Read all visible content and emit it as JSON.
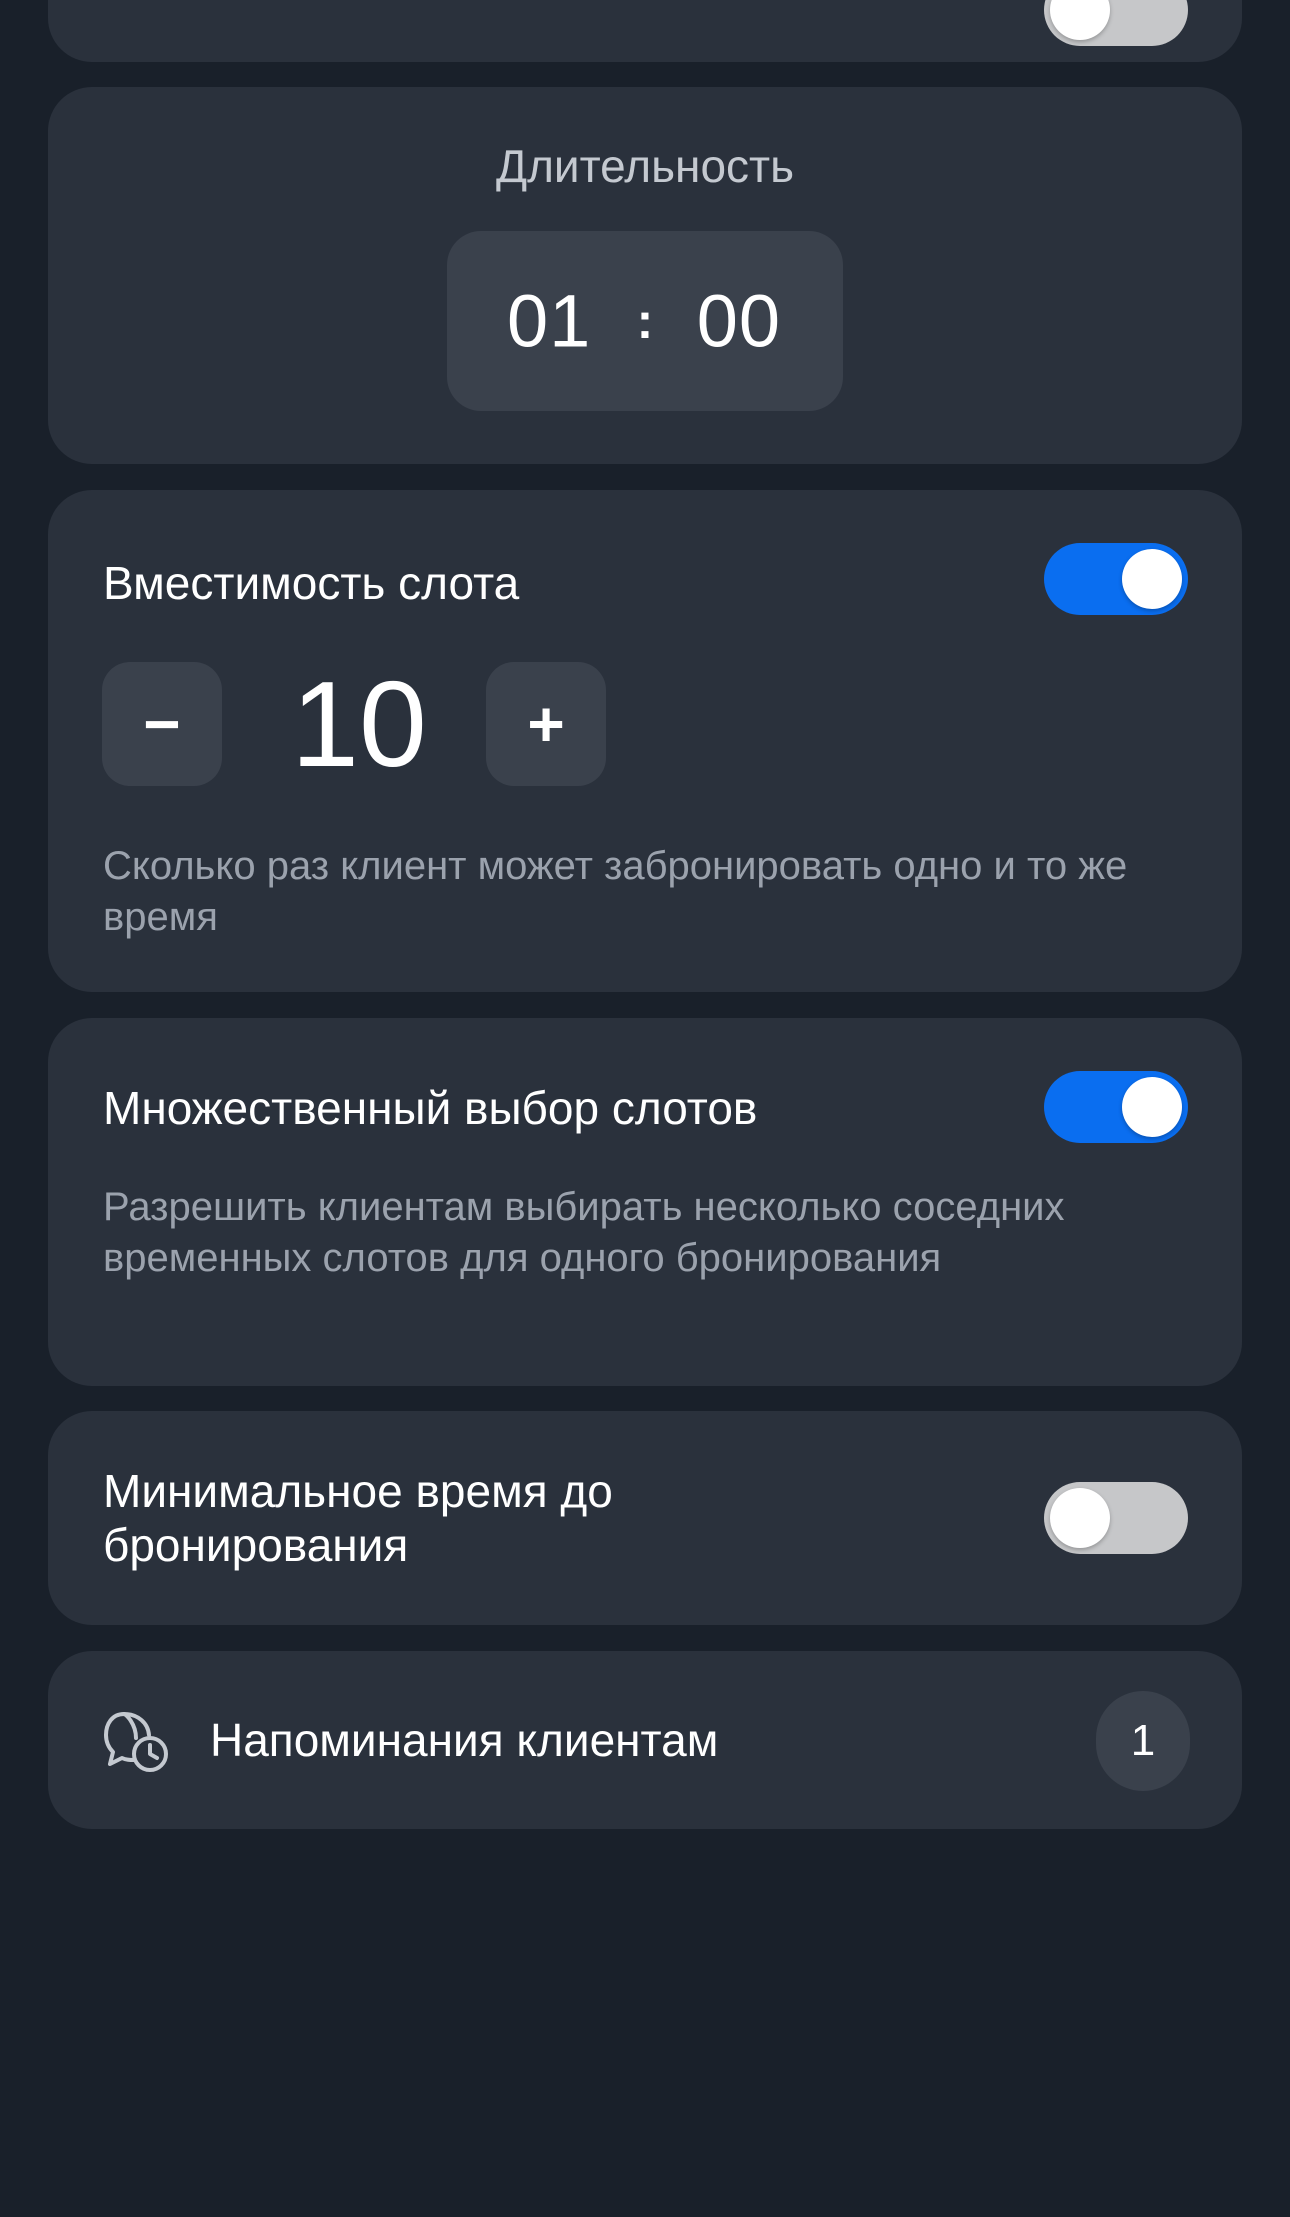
{
  "top_card": {
    "toggle_on": false
  },
  "duration": {
    "label": "Длительность",
    "hours": "01",
    "separator": ":",
    "minutes": "00"
  },
  "capacity": {
    "title": "Вместимость слота",
    "toggle_on": true,
    "minus_label": "−",
    "value": "10",
    "plus_label": "+",
    "description": "Сколько раз клиент может забронировать одно и то же время"
  },
  "multi_select": {
    "title": "Множественный выбор слотов",
    "toggle_on": true,
    "description": "Разрешить клиентам выбирать несколько соседних временных слотов для одного бронирования"
  },
  "min_time": {
    "title": "Минимальное время до бронирования",
    "toggle_on": false
  },
  "reminders": {
    "icon": "chat-clock-icon",
    "label": "Напоминания клиентам",
    "badge": "1"
  },
  "colors": {
    "background": "#19202a",
    "card": "#2a313c",
    "control": "#3a414c",
    "accent": "#0a6ef0",
    "toggle_off": "#c6c7c9",
    "secondary_text": "#9ba2ad"
  }
}
